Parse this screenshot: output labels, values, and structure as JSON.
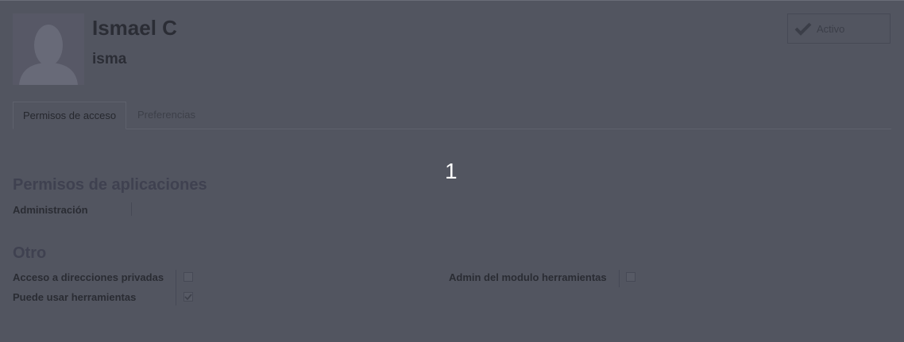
{
  "user": {
    "name": "Ismael C",
    "login": "isma"
  },
  "status_button": {
    "label": "Activo",
    "icon": "check-icon"
  },
  "tabs": [
    {
      "label": "Permisos de acceso",
      "active": true
    },
    {
      "label": "Preferencias",
      "active": false
    }
  ],
  "overlay_marker": "1",
  "sections": {
    "app_permissions": {
      "title": "Permisos de aplicaciones",
      "fields": [
        {
          "label": "Administración"
        }
      ]
    },
    "other": {
      "title": "Otro",
      "fields": [
        {
          "label": "Acceso a direcciones privadas",
          "checked": false
        },
        {
          "label": "Puede usar herramientas",
          "checked": true
        },
        {
          "label": "Admin del modulo herramientas",
          "checked": false
        }
      ]
    }
  },
  "colors": {
    "background": "#525560",
    "text": "#2a2c33",
    "overlay_text": "#ffffff"
  }
}
